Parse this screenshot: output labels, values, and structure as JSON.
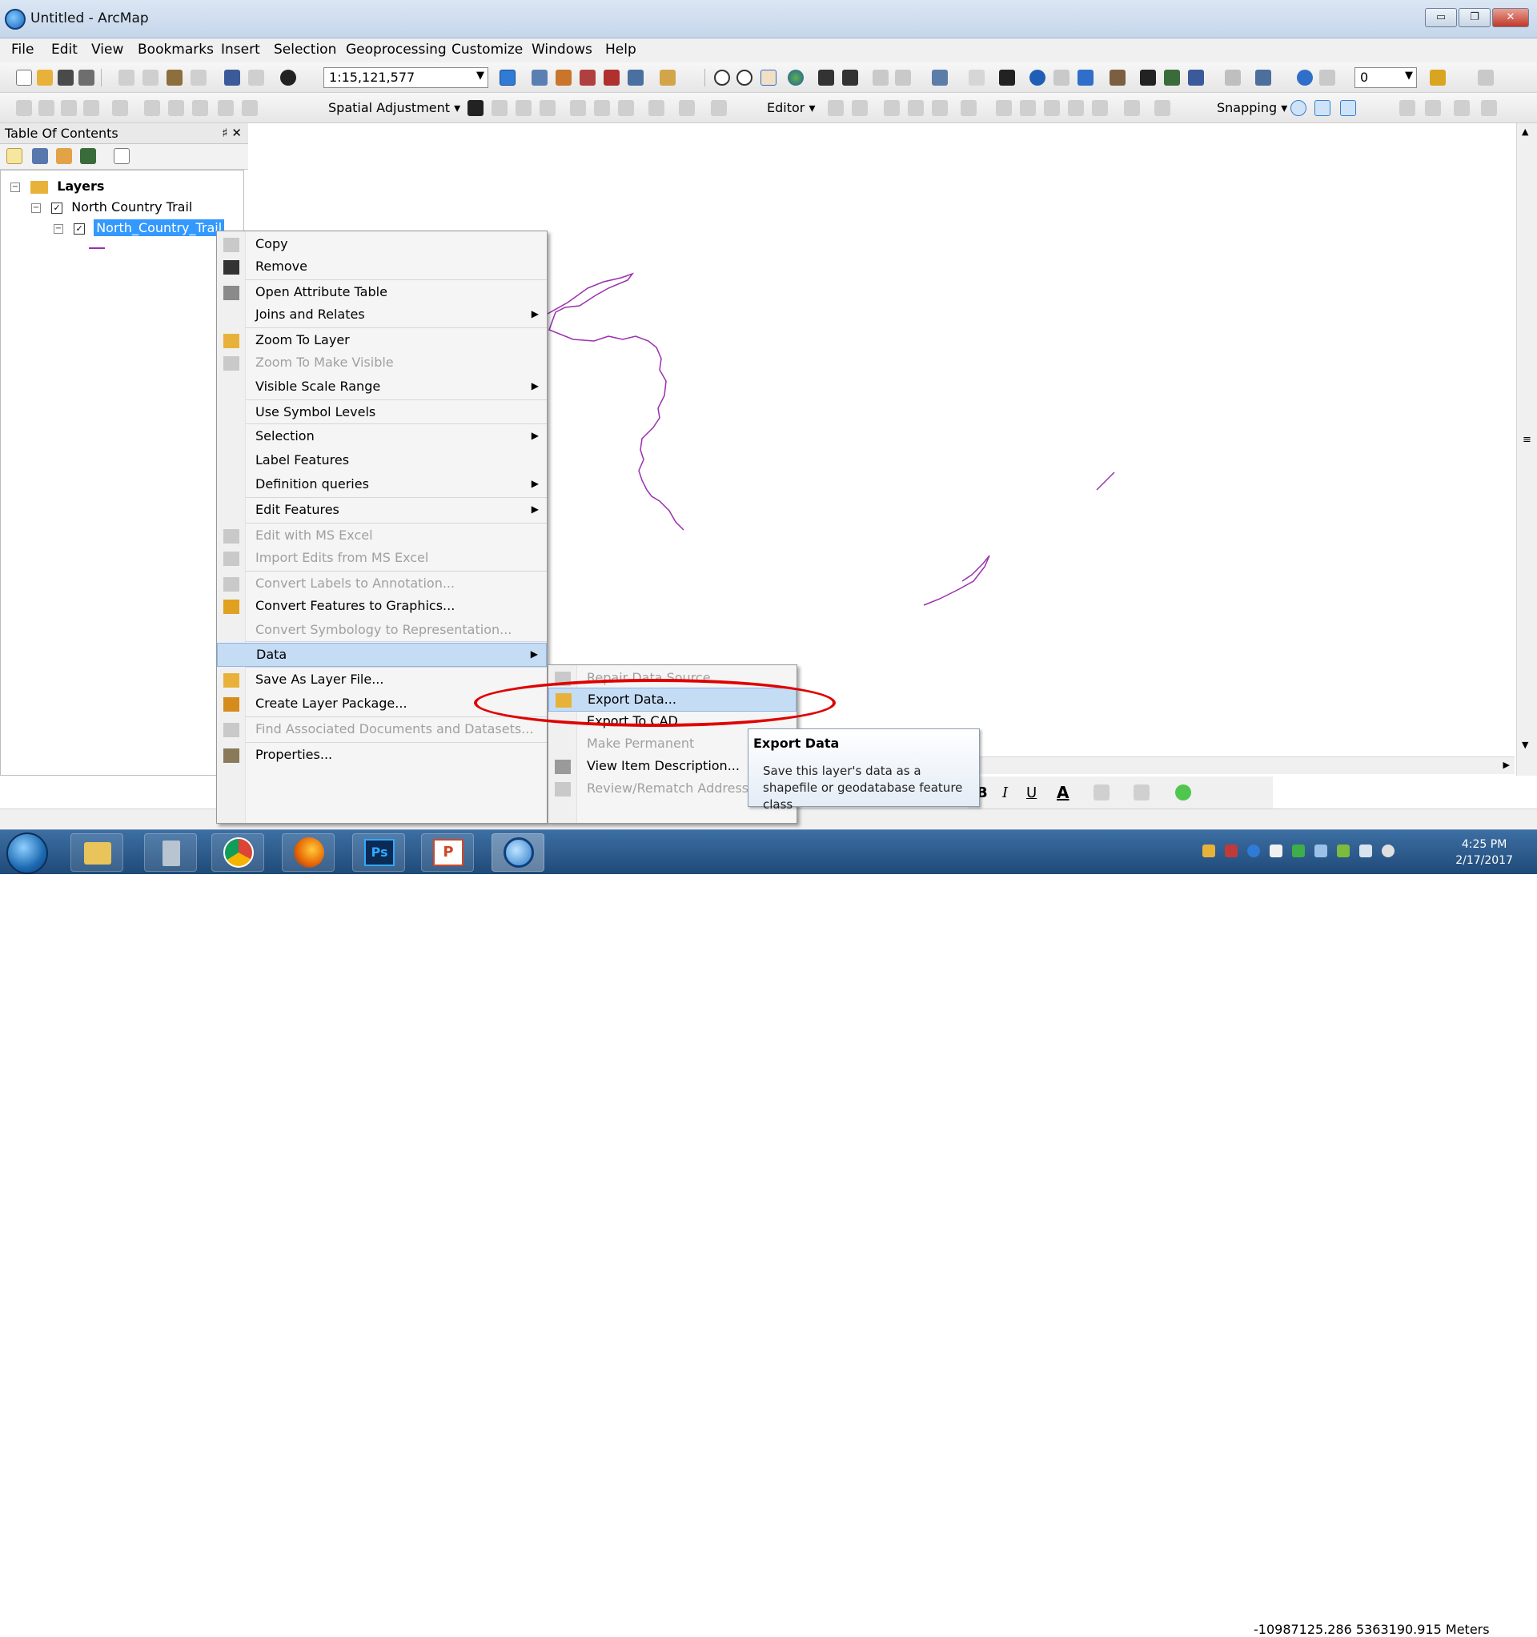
{
  "window": {
    "title": "Untitled - ArcMap",
    "min": "▭",
    "max": "❐",
    "close": "✕"
  },
  "menubar": [
    "File",
    "Edit",
    "View",
    "Bookmarks",
    "Insert",
    "Selection",
    "Geoprocessing",
    "Customize",
    "Windows",
    "Help"
  ],
  "toolbar": {
    "scale": "1:15,121,577",
    "spatial_adjustment": "Spatial Adjustment ▾",
    "editor": "Editor ▾",
    "snapping": "Snapping ▾",
    "layer_value": "0"
  },
  "toc": {
    "title": "Table Of Contents",
    "pin": "♯ ✕",
    "root": "Layers",
    "group": "North Country Trail",
    "layer": "North_Country_Trail"
  },
  "context_menu": [
    {
      "label": "Copy",
      "icon": "copy-icon",
      "enabled": true,
      "submenu": false
    },
    {
      "label": "Remove",
      "icon": "remove-icon",
      "enabled": true,
      "submenu": false
    },
    {
      "label": "Open Attribute Table",
      "icon": "table-icon",
      "enabled": true,
      "submenu": false
    },
    {
      "label": "Joins and Relates",
      "icon": "",
      "enabled": true,
      "submenu": true
    },
    {
      "label": "Zoom To Layer",
      "icon": "zoom-layer-icon",
      "enabled": true,
      "submenu": false
    },
    {
      "label": "Zoom To Make Visible",
      "icon": "zoom-visible-icon",
      "enabled": false,
      "submenu": false
    },
    {
      "label": "Visible Scale Range",
      "icon": "",
      "enabled": true,
      "submenu": true
    },
    {
      "label": "Use Symbol Levels",
      "icon": "",
      "enabled": true,
      "submenu": false
    },
    {
      "label": "Selection",
      "icon": "",
      "enabled": true,
      "submenu": true
    },
    {
      "label": "Label Features",
      "icon": "",
      "enabled": true,
      "submenu": false
    },
    {
      "label": "Definition queries",
      "icon": "",
      "enabled": true,
      "submenu": true
    },
    {
      "label": "Edit Features",
      "icon": "",
      "enabled": true,
      "submenu": true
    },
    {
      "label": "Edit with MS Excel",
      "icon": "excel-edit-icon",
      "enabled": false,
      "submenu": false
    },
    {
      "label": "Import Edits from MS Excel",
      "icon": "excel-import-icon",
      "enabled": false,
      "submenu": false
    },
    {
      "label": "Convert Labels to Annotation...",
      "icon": "annotation-icon",
      "enabled": false,
      "submenu": false
    },
    {
      "label": "Convert Features to Graphics...",
      "icon": "graphics-icon",
      "enabled": true,
      "submenu": false
    },
    {
      "label": "Convert Symbology to Representation...",
      "icon": "",
      "enabled": false,
      "submenu": false
    },
    {
      "label": "Data",
      "icon": "",
      "enabled": true,
      "submenu": true,
      "highlighted": true
    },
    {
      "label": "Save As Layer File...",
      "icon": "layer-file-icon",
      "enabled": true,
      "submenu": false
    },
    {
      "label": "Create Layer Package...",
      "icon": "layer-package-icon",
      "enabled": true,
      "submenu": false
    },
    {
      "label": "Find Associated Documents and Datasets...",
      "icon": "documents-icon",
      "enabled": false,
      "submenu": false
    },
    {
      "label": "Properties...",
      "icon": "properties-icon",
      "enabled": true,
      "submenu": false
    }
  ],
  "submenu": [
    {
      "label": "Repair Data Source...",
      "icon": "repair-icon",
      "enabled": false
    },
    {
      "label": "Export Data...",
      "icon": "export-icon",
      "enabled": true,
      "highlighted": true
    },
    {
      "label": "Export To CAD...",
      "icon": "",
      "enabled": true
    },
    {
      "label": "Make Permanent",
      "icon": "",
      "enabled": false
    },
    {
      "label": "View Item Description...",
      "icon": "description-icon",
      "enabled": true
    },
    {
      "label": "Review/Rematch Addresses...",
      "icon": "rematch-icon",
      "enabled": false
    }
  ],
  "tooltip": {
    "title": "Export Data",
    "body": "Save this layer's data as a shapefile or geodatabase feature class"
  },
  "drawbar": {
    "bold": "B",
    "italic": "I",
    "underline": "U",
    "font_color": "A"
  },
  "status": {
    "coordinates": "-10987125.286  5363190.915 Meters"
  },
  "taskbar": {
    "time": "4:25 PM",
    "date": "2/17/2017",
    "apps": [
      "explorer",
      "calculator",
      "chrome",
      "firefox",
      "Ps",
      "P",
      "arcmap"
    ]
  },
  "colors": {
    "trail": "#9b2fb0",
    "highlight": "#c5dcf5",
    "annotation": "#e00000"
  }
}
